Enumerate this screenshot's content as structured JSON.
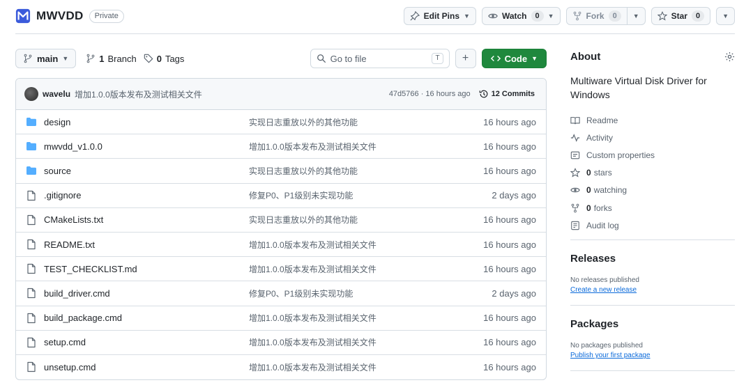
{
  "repo": {
    "name": "MWVDD",
    "visibility": "Private",
    "logo_color": "#3b5bdb"
  },
  "header_actions": {
    "edit_pins": "Edit Pins",
    "watch": "Watch",
    "watch_count": "0",
    "fork": "Fork",
    "fork_count": "0",
    "star": "Star",
    "star_count": "0"
  },
  "toolbar": {
    "branch": "main",
    "branches_count": "1",
    "branches_label": "Branch",
    "tags_count": "0",
    "tags_label": "Tags",
    "goto_placeholder": "Go to file",
    "goto_key": "T",
    "code_label": "Code"
  },
  "latest_commit": {
    "author": "wavelu",
    "message": "增加1.0.0版本发布及测试相关文件",
    "meta": "47d5766 · 16 hours ago",
    "commits": "12 Commits"
  },
  "files": [
    {
      "type": "folder",
      "name": "design",
      "message": "实现日志重放以外的其他功能",
      "date": "16 hours ago"
    },
    {
      "type": "folder",
      "name": "mwvdd_v1.0.0",
      "message": "增加1.0.0版本发布及测试相关文件",
      "date": "16 hours ago"
    },
    {
      "type": "folder",
      "name": "source",
      "message": "实现日志重放以外的其他功能",
      "date": "16 hours ago"
    },
    {
      "type": "file",
      "name": ".gitignore",
      "message": "修复P0、P1级别未实现功能",
      "date": "2 days ago"
    },
    {
      "type": "file",
      "name": "CMakeLists.txt",
      "message": "实现日志重放以外的其他功能",
      "date": "16 hours ago"
    },
    {
      "type": "file",
      "name": "README.txt",
      "message": "增加1.0.0版本发布及测试相关文件",
      "date": "16 hours ago"
    },
    {
      "type": "file",
      "name": "TEST_CHECKLIST.md",
      "message": "增加1.0.0版本发布及测试相关文件",
      "date": "16 hours ago"
    },
    {
      "type": "file",
      "name": "build_driver.cmd",
      "message": "修复P0、P1级别未实现功能",
      "date": "2 days ago"
    },
    {
      "type": "file",
      "name": "build_package.cmd",
      "message": "增加1.0.0版本发布及测试相关文件",
      "date": "16 hours ago"
    },
    {
      "type": "file",
      "name": "setup.cmd",
      "message": "增加1.0.0版本发布及测试相关文件",
      "date": "16 hours ago"
    },
    {
      "type": "file",
      "name": "unsetup.cmd",
      "message": "增加1.0.0版本发布及测试相关文件",
      "date": "16 hours ago"
    }
  ],
  "about": {
    "title": "About",
    "description": "Multiware Virtual Disk Driver for Windows",
    "readme": "Readme",
    "activity": "Activity",
    "custom_properties": "Custom properties",
    "stars_count": "0",
    "stars_label": "stars",
    "watching_count": "0",
    "watching_label": "watching",
    "forks_count": "0",
    "forks_label": "forks",
    "audit_log": "Audit log"
  },
  "releases": {
    "title": "Releases",
    "note": "No releases published",
    "link": "Create a new release"
  },
  "packages": {
    "title": "Packages",
    "note": "No packages published",
    "link": "Publish your first package"
  },
  "colors": {
    "folder": "#54aeff",
    "code_button": "#1f883d",
    "link": "#0969da"
  }
}
